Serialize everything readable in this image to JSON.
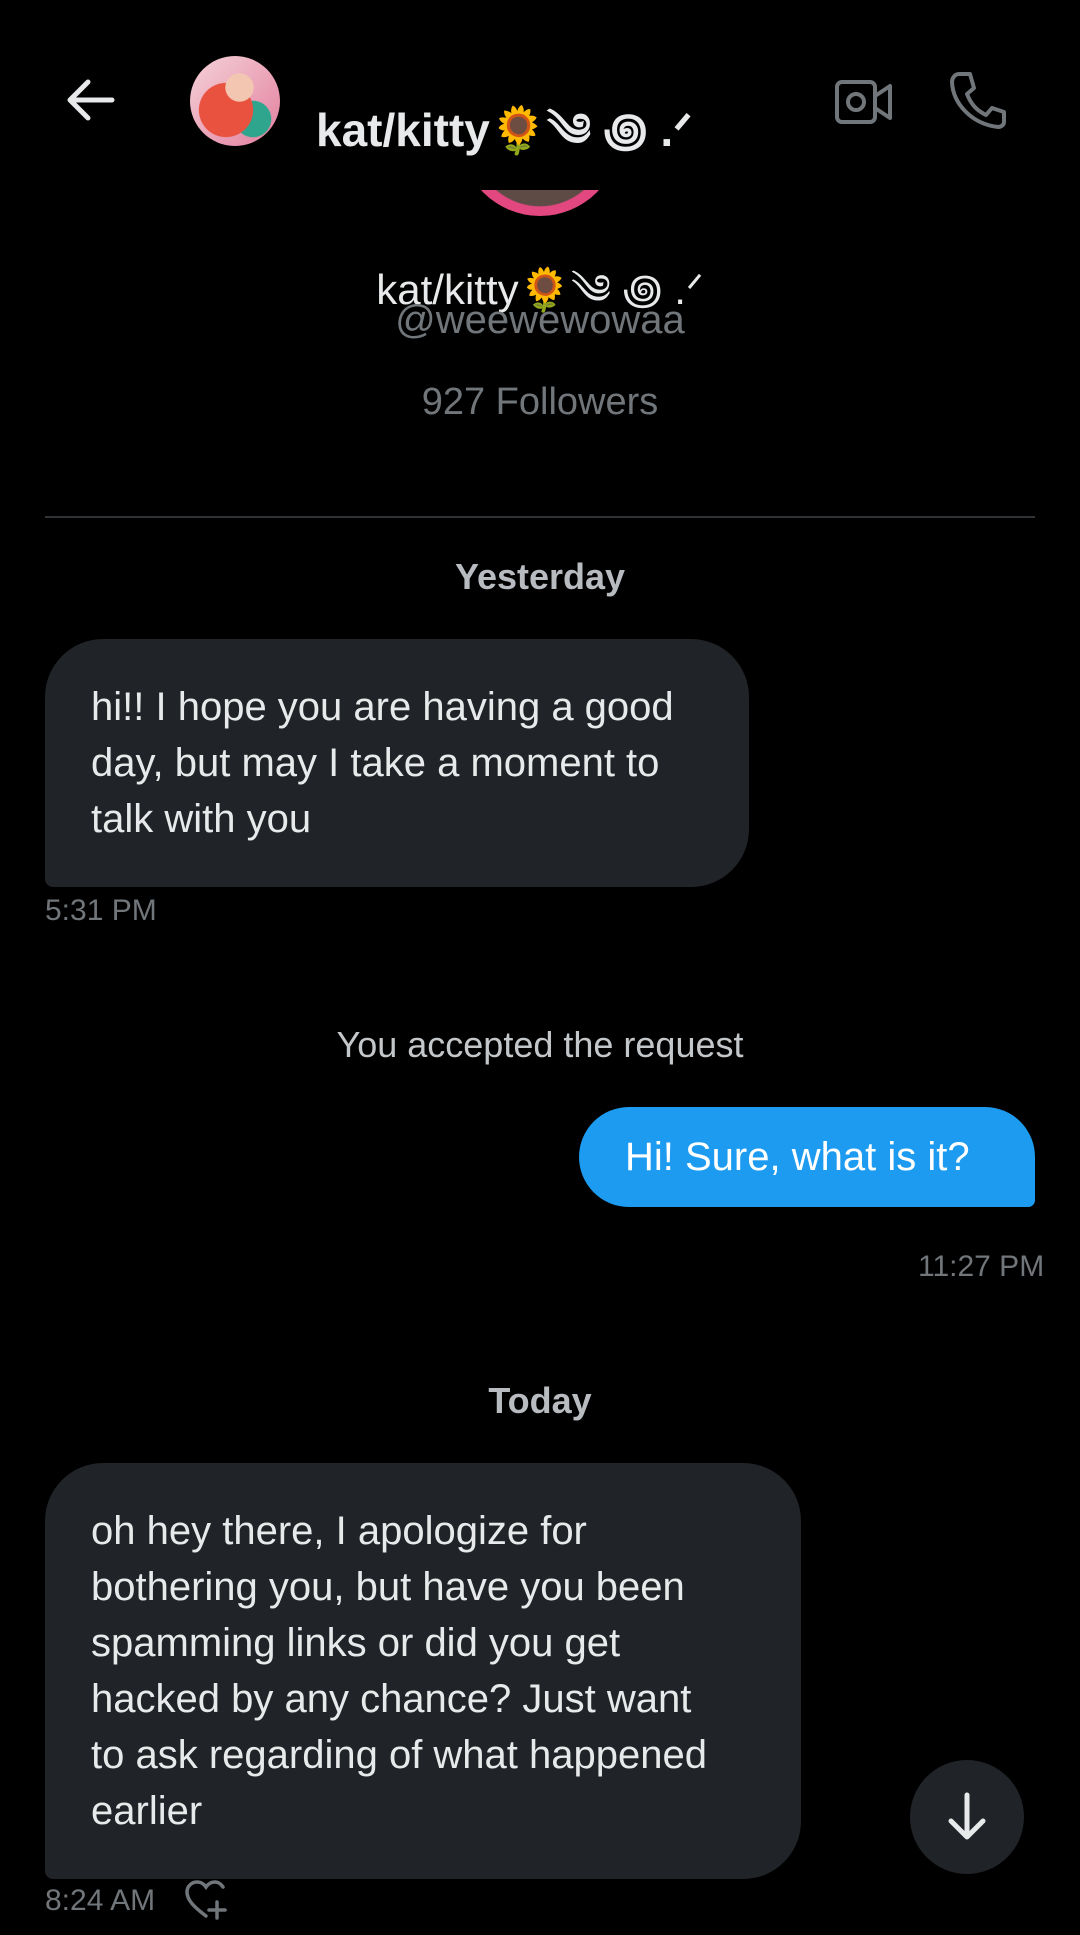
{
  "header": {
    "title": "kat/kitty🌻༄ ꩜ .ᐟ",
    "back_icon": "arrow-left-icon",
    "video_icon": "video-call-icon",
    "phone_icon": "phone-icon"
  },
  "profile": {
    "display_name": "kat/kitty🌻༄ ꩜ .ᐟ",
    "handle": "@weewewowaa",
    "followers": "927 Followers"
  },
  "conversation": {
    "separators": {
      "yesterday": "Yesterday",
      "today": "Today"
    },
    "system_note": "You accepted the request",
    "messages": [
      {
        "direction": "incoming",
        "lines": [
          "hi!! I hope you are having a good",
          "day, but may I take a moment to",
          "talk with you"
        ],
        "time": "5:31 PM"
      },
      {
        "direction": "outgoing",
        "lines": [
          "Hi! Sure, what is it?"
        ],
        "time": "11:27 PM"
      },
      {
        "direction": "incoming",
        "lines": [
          "oh hey there, I apologize for",
          "bothering you, but have you been",
          "spamming links or did you get",
          "hacked by any chance? Just want",
          "to ask regarding of what happened",
          "earlier"
        ],
        "time": "8:24 AM"
      }
    ]
  },
  "colors": {
    "background": "#000000",
    "incoming_bubble": "#202327",
    "outgoing_bubble": "#1d9bf0",
    "secondary_text": "#71767b"
  },
  "controls": {
    "scroll_down_icon": "arrow-down-icon",
    "react_icon": "heart-plus-icon"
  }
}
